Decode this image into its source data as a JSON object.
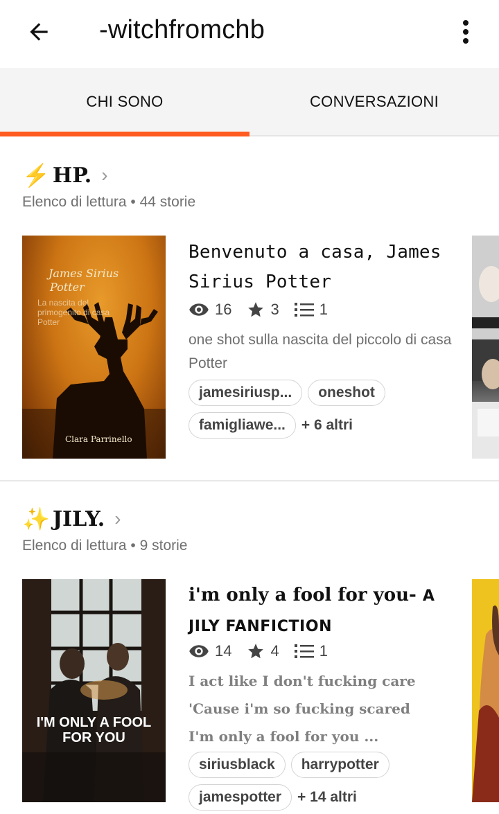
{
  "header": {
    "title": "-witchfromchb"
  },
  "tabs": [
    {
      "label": "CHI SONO"
    },
    {
      "label": "CONVERSAZIONI"
    }
  ],
  "colors": {
    "accent": "#ff5a1f"
  },
  "lists": [
    {
      "emoji": "⚡",
      "name": "HP.",
      "meta": "Elenco di lettura • 44 storie",
      "story": {
        "title": "Benvenuto a casa, James Sirius Potter",
        "views": "16",
        "votes": "3",
        "parts": "1",
        "description": "one shot sulla nascita del piccolo di casa Potter",
        "tags": [
          "jamesiriusp...",
          "oneshot",
          "famigliawe..."
        ],
        "more": "+ 6 altri",
        "cover": {
          "title_line1": "James Sirius",
          "title_line2": "Potter",
          "subtitle": "La nascita del primogenito di casa Potter",
          "author": "Clara Parrinello"
        }
      }
    },
    {
      "emoji": "✨",
      "name": "JILY.",
      "meta": "Elenco di lettura • 9 storie",
      "story": {
        "title_main": "i'm only a fool for you- ",
        "title_caps": "A JILY FANFICTION",
        "views": "14",
        "votes": "4",
        "parts": "1",
        "description_lines": [
          "I act like I don't fucking care",
          "'Cause i'm so fucking scared",
          "I'm only a fool for you ..."
        ],
        "tags": [
          "siriusblack",
          "harrypotter",
          "jamespotter"
        ],
        "more": "+ 14 altri",
        "cover": {
          "text": "I'M ONLY A FOOL FOR YOU"
        }
      }
    }
  ]
}
